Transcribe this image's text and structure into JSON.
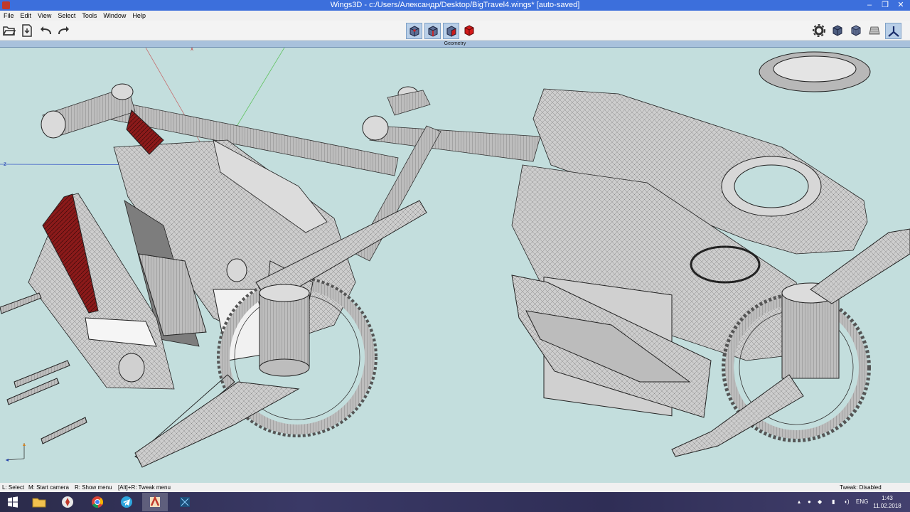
{
  "window": {
    "title": "Wings3D - c:/Users/Александр/Desktop/BigTravel4.wings* [auto-saved]",
    "controls": [
      "‒",
      "❐",
      "✕"
    ]
  },
  "menu": [
    "File",
    "Edit",
    "View",
    "Select",
    "Tools",
    "Window",
    "Help"
  ],
  "toolbar": {
    "left_icons": [
      "open-folder-icon",
      "save-icon",
      "undo-icon",
      "redo-icon"
    ],
    "selection_modes": [
      "vertex-select-icon",
      "edge-select-icon",
      "face-select-icon",
      "body-select-icon"
    ],
    "right_icons": [
      "preferences-icon",
      "smooth-shading-icon",
      "wireframe-icon",
      "grid-icon",
      "perspective-icon"
    ]
  },
  "geometry_label": "Geometry",
  "viewport": {
    "axes": {
      "x": "x",
      "z": "z"
    },
    "colors": {
      "background": "#c3dedd",
      "mesh": "#c8c8c8",
      "accent": "#8b1a1a"
    }
  },
  "statusbar": {
    "hints": [
      "L: Select",
      "M: Start camera",
      "R: Show menu",
      "[Alt]+R: Tweak menu"
    ],
    "tweak": "Tweak: Disabled"
  },
  "taskbar": {
    "apps": [
      "start-icon",
      "file-explorer-icon",
      "app-icon",
      "chrome-icon",
      "telegram-icon",
      "wings3d-icon",
      "app2-icon"
    ],
    "language": "ENG",
    "time": "1:43",
    "date": "11.02.2018"
  }
}
